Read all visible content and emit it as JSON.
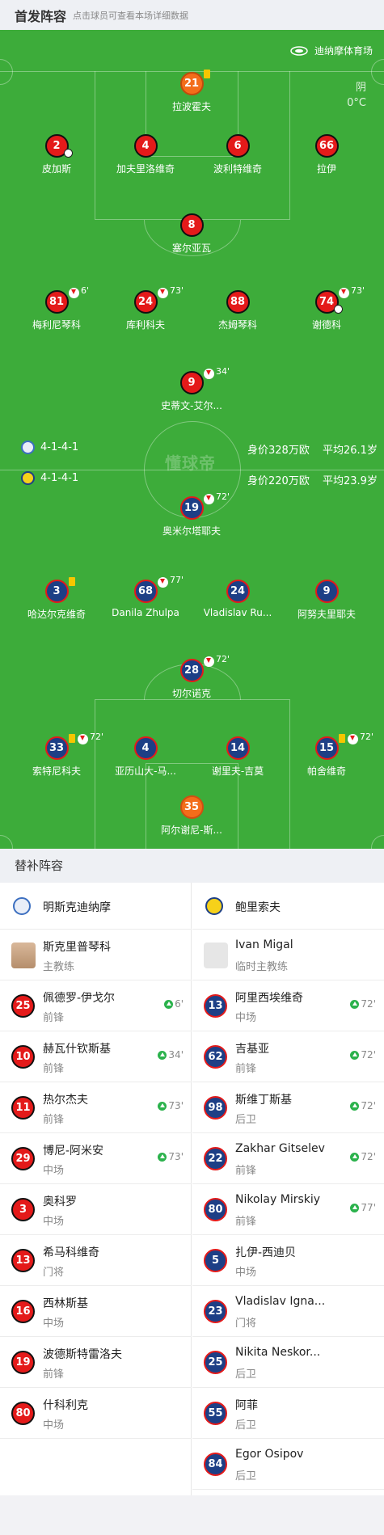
{
  "header": {
    "title": "首发阵容",
    "hint": "点击球员可查看本场详细数据"
  },
  "pitch": {
    "venue": "迪纳摩体育场",
    "weather": "阴",
    "temperature": "0°C",
    "watermark": "懂球帝"
  },
  "home_team": {
    "formation": "4-1-4-1",
    "value": "身价328万欧",
    "age": "平均26.1岁",
    "color": "#e41a1a"
  },
  "away_team": {
    "formation": "4-1-4-1",
    "value": "身价220万欧",
    "age": "平均23.9岁",
    "color": "#1d3f86"
  },
  "home_players": [
    {
      "num": "21",
      "name": "拉波霍夫",
      "card": true
    },
    {
      "num": "2",
      "name": "皮加斯",
      "goal": true
    },
    {
      "num": "4",
      "name": "加夫里洛维奇"
    },
    {
      "num": "6",
      "name": "波利特维奇"
    },
    {
      "num": "66",
      "name": "拉伊"
    },
    {
      "num": "8",
      "name": "塞尔亚瓦"
    },
    {
      "num": "81",
      "name": "梅利尼琴科",
      "sub": "6'"
    },
    {
      "num": "24",
      "name": "库利科夫",
      "sub": "73'"
    },
    {
      "num": "88",
      "name": "杰姆琴科"
    },
    {
      "num": "74",
      "name": "谢德科",
      "sub": "73'",
      "goal": true
    },
    {
      "num": "9",
      "name": "史蒂文-艾尔...",
      "sub": "34'"
    }
  ],
  "away_players": [
    {
      "num": "19",
      "name": "奥米尔塔耶夫",
      "sub": "72'"
    },
    {
      "num": "3",
      "name": "哈达尔克维奇",
      "card": true
    },
    {
      "num": "68",
      "name": "Danila Zhulpa",
      "sub": "77'"
    },
    {
      "num": "24",
      "name": "Vladislav Ru..."
    },
    {
      "num": "9",
      "name": "阿努夫里耶夫"
    },
    {
      "num": "28",
      "name": "切尔诺克",
      "sub": "72'"
    },
    {
      "num": "33",
      "name": "索特尼科夫",
      "sub": "72'",
      "card": true
    },
    {
      "num": "4",
      "name": "亚历山大-马..."
    },
    {
      "num": "14",
      "name": "谢里夫-吉莫"
    },
    {
      "num": "15",
      "name": "帕舍维奇",
      "sub": "72'",
      "card": true
    },
    {
      "num": "35",
      "name": "阿尔谢尼-斯..."
    }
  ],
  "subs": {
    "title": "替补阵容",
    "home": {
      "team_name": "明斯克迪纳摩",
      "coach": {
        "name": "斯克里普琴科",
        "role": "主教练"
      },
      "players": [
        {
          "num": "25",
          "name": "佩德罗-伊戈尔",
          "pos": "前锋",
          "min": "6'"
        },
        {
          "num": "10",
          "name": "赫瓦什钦斯基",
          "pos": "前锋",
          "min": "34'"
        },
        {
          "num": "11",
          "name": "热尔杰夫",
          "pos": "前锋",
          "min": "73'"
        },
        {
          "num": "29",
          "name": "博尼-阿米安",
          "pos": "中场",
          "min": "73'"
        },
        {
          "num": "3",
          "name": "奥科罗",
          "pos": "中场",
          "min": ""
        },
        {
          "num": "13",
          "name": "希马科维奇",
          "pos": "门将",
          "min": ""
        },
        {
          "num": "16",
          "name": "西林斯基",
          "pos": "中场",
          "min": ""
        },
        {
          "num": "19",
          "name": "波德斯特雷洛夫",
          "pos": "前锋",
          "min": ""
        },
        {
          "num": "80",
          "name": "什科利克",
          "pos": "中场",
          "min": ""
        }
      ]
    },
    "away": {
      "team_name": "鲍里索夫",
      "coach": {
        "name": "Ivan Migal",
        "role": "临时主教练"
      },
      "players": [
        {
          "num": "13",
          "name": "阿里西埃维奇",
          "pos": "中场",
          "min": "72'"
        },
        {
          "num": "62",
          "name": "吉基亚",
          "pos": "前锋",
          "min": "72'"
        },
        {
          "num": "98",
          "name": "斯维丁斯基",
          "pos": "后卫",
          "min": "72'"
        },
        {
          "num": "22",
          "name": "Zakhar Gitselev",
          "pos": "前锋",
          "min": "72'"
        },
        {
          "num": "80",
          "name": "Nikolay Mirskiy",
          "pos": "前锋",
          "min": "77'"
        },
        {
          "num": "5",
          "name": "扎伊-西迪贝",
          "pos": "中场",
          "min": ""
        },
        {
          "num": "23",
          "name": "Vladislav Igna...",
          "pos": "门将",
          "min": ""
        },
        {
          "num": "25",
          "name": "Nikita Neskor...",
          "pos": "后卫",
          "min": ""
        },
        {
          "num": "55",
          "name": "阿菲",
          "pos": "后卫",
          "min": ""
        },
        {
          "num": "84",
          "name": "Egor Osipov",
          "pos": "后卫",
          "min": ""
        }
      ]
    }
  }
}
